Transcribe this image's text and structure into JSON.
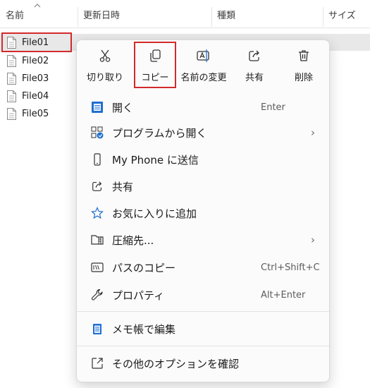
{
  "header": {
    "col_name": "名前",
    "col_date": "更新日時",
    "col_type": "種類",
    "col_size": "サイズ"
  },
  "files": [
    "File01",
    "File02",
    "File03",
    "File04",
    "File05"
  ],
  "toolbar": {
    "cut": "切り取り",
    "copy": "コピー",
    "rename": "名前の変更",
    "share": "共有",
    "delete": "削除"
  },
  "menu": {
    "open": {
      "label": "開く",
      "shortcut": "Enter"
    },
    "open_with": {
      "label": "プログラムから開く"
    },
    "send_phone": {
      "label": "My Phone に送信"
    },
    "share": {
      "label": "共有"
    },
    "favorites": {
      "label": "お気に入りに追加"
    },
    "compress": {
      "label": "圧縮先..."
    },
    "copy_path": {
      "label": "パスのコピー",
      "shortcut": "Ctrl+Shift+C"
    },
    "properties": {
      "label": "プロパティ",
      "shortcut": "Alt+Enter"
    },
    "notepad": {
      "label": "メモ帳で編集"
    },
    "more_options": {
      "label": "その他のオプションを確認"
    }
  },
  "colors": {
    "highlight_red": "#d32a2a",
    "accent_blue": "#1f6fd1",
    "selection_gray": "#e8e8e8"
  },
  "icons": {
    "cut": "scissors-icon",
    "copy": "copy-icon",
    "rename": "rename-icon",
    "share": "share-icon",
    "delete": "trash-icon"
  }
}
